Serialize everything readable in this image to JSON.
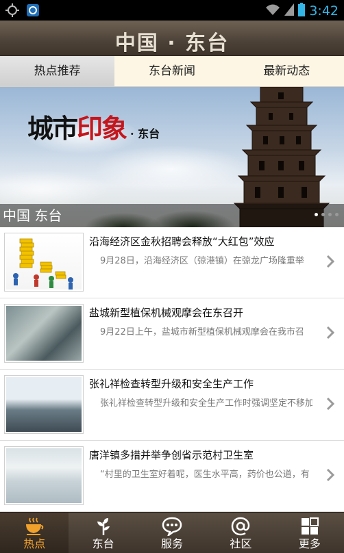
{
  "status_bar": {
    "time": "3:42"
  },
  "app_title": "中国 · 东台",
  "tabs": [
    {
      "label": "热点推荐",
      "active": true
    },
    {
      "label": "东台新闻",
      "active": false
    },
    {
      "label": "最新动态",
      "active": false
    }
  ],
  "banner": {
    "calligraphy_main": "城市",
    "calligraphy_red": "印象",
    "calligraphy_suffix": "· 东台",
    "caption": "中国 东台",
    "page_count": 4,
    "active_page": 1
  },
  "news": [
    {
      "title": "沿海经济区金秋招聘会释放“大红包”效应",
      "summary": "9月28日，沿海经济区（弶港镇）在弶龙广场隆重举"
    },
    {
      "title": "盐城新型植保机械观摩会在东召开",
      "summary": "9月22日上午，盐城市新型植保机械观摩会在我市召"
    },
    {
      "title": "张礼祥检查转型升级和安全生产工作",
      "summary": "张礼祥检查转型升级和安全生产工作时强调坚定不移加"
    },
    {
      "title": "唐洋镇多措并举争创省示范村卫生室",
      "summary": "“村里的卫生室好着呢，医生水平高，药价也公道，有"
    }
  ],
  "bottom_nav": [
    {
      "label": "热点",
      "icon": "coffee-cup-icon",
      "active": true
    },
    {
      "label": "东台",
      "icon": "sprout-icon",
      "active": false
    },
    {
      "label": "服务",
      "icon": "chat-bubble-icon",
      "active": false
    },
    {
      "label": "社区",
      "icon": "at-sign-icon",
      "active": false
    },
    {
      "label": "更多",
      "icon": "grid-icon",
      "active": false
    }
  ],
  "colors": {
    "accent": "#f0a12c",
    "status_blue": "#33b5e5",
    "titlebar": "#4d4237"
  }
}
